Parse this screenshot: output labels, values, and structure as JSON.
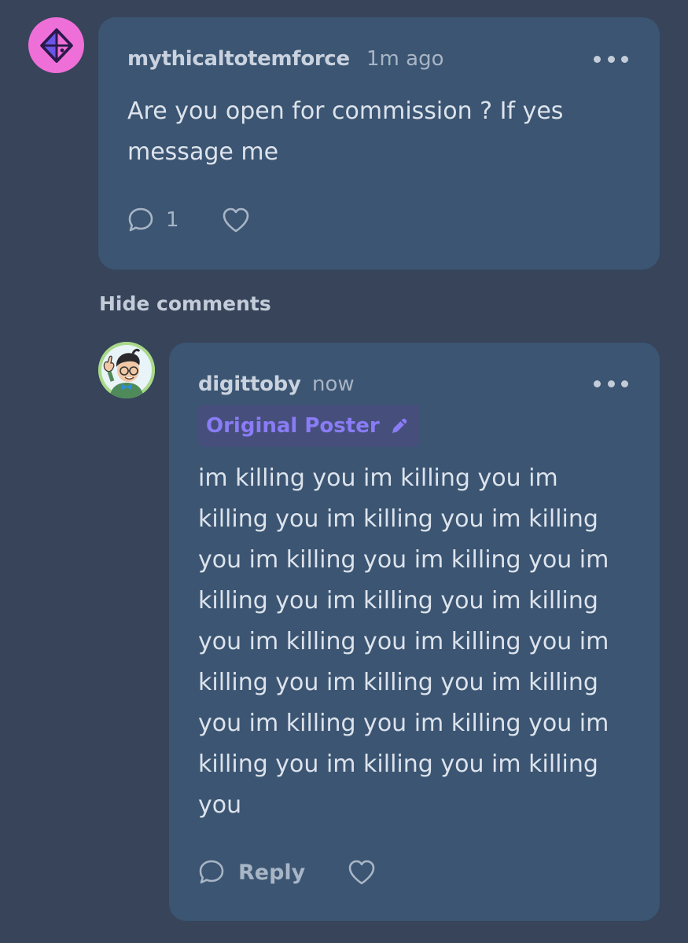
{
  "colors": {
    "background": "#37445a",
    "card": "#3b5572",
    "avatar_pink": "#ef6fd8",
    "badge_bg": "#464f7c",
    "badge_text": "#8a7cf6"
  },
  "first_comment": {
    "username": "mythicaltotemforce",
    "timestamp": "1m ago",
    "body_lines": [
      "Are you open for commission  ? If yes",
      "message me"
    ],
    "reply_count": "1",
    "icons": {
      "avatar": "d20-dice-avatar-icon",
      "more": "more-options-icon",
      "comment": "comment-bubble-icon",
      "like": "heart-icon"
    }
  },
  "hide_comments_label": "Hide comments",
  "reply_comment": {
    "username": "digittoby",
    "timestamp": "now",
    "badge_label": "Original Poster",
    "body_lines": [
      "im killing you im killing you im",
      "killing you im killing you im killing",
      "you im killing you im killing you im",
      "killing you im killing you im killing",
      "you im killing you im killing you im",
      "killing you im killing you im killing",
      "you im killing you im killing you im",
      "killing you im killing you im killing",
      "you"
    ],
    "reply_label": "Reply",
    "icons": {
      "avatar": "cartoon-character-avatar-icon",
      "badge": "pencil-icon",
      "more": "more-options-icon",
      "reply": "comment-bubble-icon",
      "like": "heart-icon"
    }
  }
}
